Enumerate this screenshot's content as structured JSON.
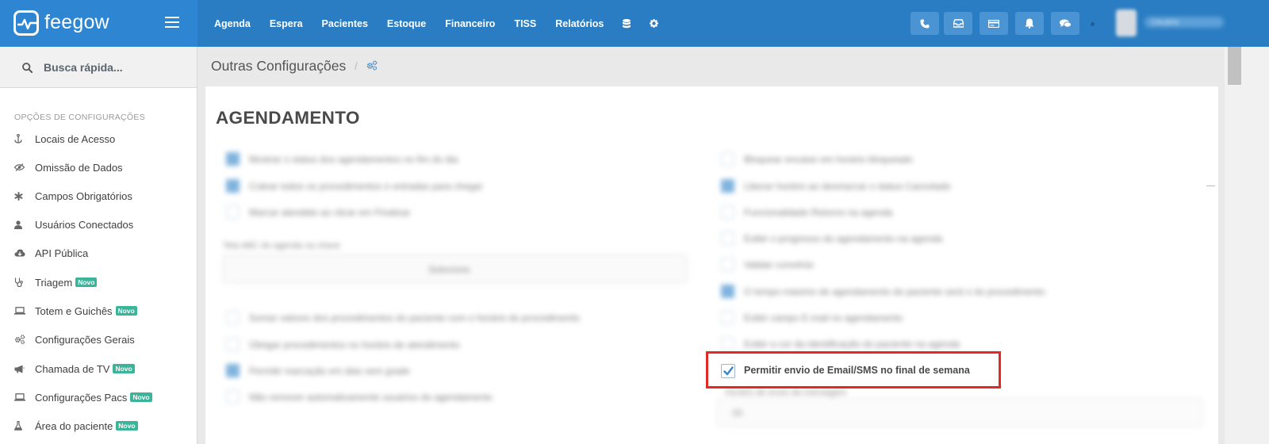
{
  "app": {
    "logo_text": "feegow"
  },
  "nav": {
    "items": [
      "Agenda",
      "Espera",
      "Pacientes",
      "Estoque",
      "Financeiro",
      "TISS",
      "Relatórios"
    ],
    "extra_icons": [
      "database-icon",
      "gear-icon"
    ]
  },
  "top_buttons": [
    "phone-icon",
    "inbox-icon",
    "card-icon",
    "bell-icon",
    "chat-icon"
  ],
  "user": {
    "name": "Usuário"
  },
  "search": {
    "placeholder": "Busca rápida..."
  },
  "sidebar": {
    "heading": "OPÇÕES DE CONFIGURAÇÕES",
    "items": [
      {
        "label": "Locais de Acesso",
        "icon": "anchor-icon",
        "badge": ""
      },
      {
        "label": "Omissão de Dados",
        "icon": "eye-slash-icon",
        "badge": ""
      },
      {
        "label": "Campos Obrigatórios",
        "icon": "asterisk-icon",
        "badge": ""
      },
      {
        "label": "Usuários Conectados",
        "icon": "user-icon",
        "badge": ""
      },
      {
        "label": "API Pública",
        "icon": "cloud-icon",
        "badge": ""
      },
      {
        "label": "Triagem",
        "icon": "stethoscope-icon",
        "badge": "Novo"
      },
      {
        "label": "Totem e Guichês",
        "icon": "laptop-icon",
        "badge": "Novo"
      },
      {
        "label": "Configurações Gerais",
        "icon": "cogs-icon",
        "badge": ""
      },
      {
        "label": "Chamada de TV",
        "icon": "bullhorn-icon",
        "badge": "Novo"
      },
      {
        "label": "Configurações Pacs",
        "icon": "laptop-icon",
        "badge": "Novo"
      },
      {
        "label": "Área do paciente",
        "icon": "flask-icon",
        "badge": "Novo"
      }
    ]
  },
  "breadcrumb": {
    "title": "Outras Configurações",
    "separator": "/"
  },
  "content": {
    "section_title": "AGENDAMENTO",
    "left_options": [
      {
        "text": "Mostrar o status dos agendamentos no fim do dia",
        "checked": true
      },
      {
        "text": "Cobrar todos os procedimentos e entradas para chegar",
        "checked": true
      },
      {
        "text": "Marcar atendido ao clicar em Finalizar",
        "checked": false
      }
    ],
    "select_label": "Tela ABC do agenda na chave",
    "select_value": "Selecione",
    "left_options_2": [
      {
        "text": "Somar valores dos procedimentos do paciente com o horário do procedimento",
        "checked": false
      },
      {
        "text": "Obrigar procedimentos no horário de atendimento",
        "checked": false
      },
      {
        "text": "Permitir marcação em dias sem grade",
        "checked": true
      },
      {
        "text": "Não remover automaticamente usuários do agendamento",
        "checked": false
      }
    ],
    "right_options": [
      {
        "text": "Bloquear encaixe em horário bloqueado",
        "checked": false
      },
      {
        "text": "Liberar horário ao desmarcar o status Cancelado",
        "checked": true
      },
      {
        "text": "Funcionalidade Retorno na agenda",
        "checked": false
      },
      {
        "text": "Exibir o progresso do agendamento na agenda",
        "checked": false
      },
      {
        "text": "Validar convênio",
        "checked": false
      },
      {
        "text": "O tempo máximo de agendamento do paciente será o do procedimento",
        "checked": true
      },
      {
        "text": "Exibir campo E-mail no agendamento",
        "checked": false
      },
      {
        "text": "Exibir a cor da identificação do paciente na agenda",
        "checked": false
      }
    ],
    "highlighted_option": {
      "text": "Permitir envio de Email/SMS no final de semana",
      "checked": true
    },
    "input_label": "Horário de envio da mensagem",
    "input_value": "00"
  },
  "colors": {
    "topbar": "#2a7dc2",
    "logo_area": "#2e86d2",
    "highlight_border": "#e02a23",
    "badge": "#3bb49a"
  }
}
